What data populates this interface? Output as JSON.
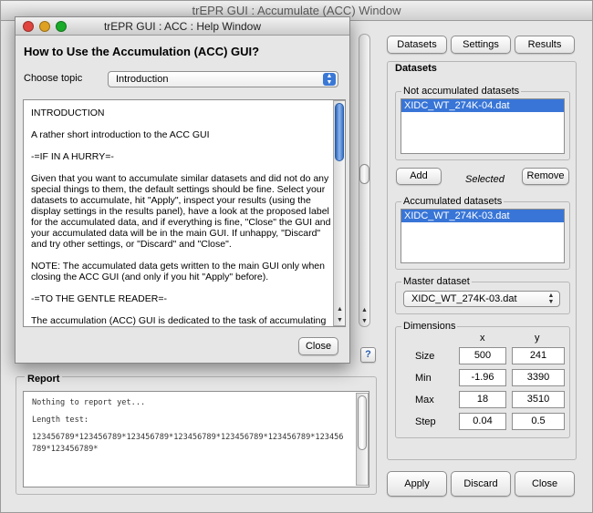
{
  "main_window": {
    "title": "trEPR GUI : Accumulate (ACC) Window"
  },
  "top_buttons": {
    "datasets": "Datasets",
    "settings": "Settings",
    "results": "Results"
  },
  "datasets_panel": {
    "title": "Datasets",
    "not_accumulated": {
      "title": "Not accumulated datasets",
      "items": [
        "XIDC_WT_274K-04.dat"
      ]
    },
    "add_button": "Add",
    "selected_label": "Selected",
    "remove_button": "Remove",
    "accumulated": {
      "title": "Accumulated datasets",
      "items": [
        "XIDC_WT_274K-03.dat"
      ]
    },
    "master": {
      "title": "Master dataset",
      "value": "XIDC_WT_274K-03.dat"
    },
    "dimensions": {
      "title": "Dimensions",
      "col_x": "x",
      "col_y": "y",
      "rows": [
        {
          "label": "Size",
          "x": "500",
          "y": "241"
        },
        {
          "label": "Min",
          "x": "-1.96",
          "y": "3390"
        },
        {
          "label": "Max",
          "x": "18",
          "y": "3510"
        },
        {
          "label": "Step",
          "x": "0.04",
          "y": "0.5"
        }
      ]
    }
  },
  "bottom_buttons": {
    "apply": "Apply",
    "discard": "Discard",
    "close": "Close"
  },
  "help_button": "?",
  "report": {
    "title": "Report",
    "lines": [
      "Nothing to report yet...",
      "Length test:",
      "123456789*123456789*123456789*123456789*123456789*123456789*123456789*123456789*"
    ]
  },
  "help_window": {
    "title": "trEPR GUI : ACC : Help Window",
    "heading": "How to Use the Accumulation (ACC) GUI?",
    "topic_label": "Choose topic",
    "topic_value": "Introduction",
    "paragraphs": [
      "INTRODUCTION",
      "A rather short introduction to the ACC GUI",
      "-=IF IN A HURRY=-",
      "Given that you want to accumulate similar datasets and did not do any special things to them, the default settings should be fine. Select your datasets to accumulate, hit \"Apply\", inspect your results (using the display settings in the results panel), have a look at the proposed label for the accumulated data, and if everything is fine, \"Close\" the GUI and your accumulated data will be in the main GUI. If unhappy, \"Discard\" and try other settings, or \"Discard\" and \"Close\".",
      "NOTE: The accumulated data gets written to the main GUI only when closing the ACC GUI (and only if you hit \"Apply\" before).",
      "-=TO THE GENTLE READER=-",
      "The accumulation (ACC) GUI is dedicated to the task of accumulating multiple datasets. Basically, it does not care about what data you want to"
    ],
    "close_button": "Close"
  },
  "colors": {
    "selection": "#3875d7",
    "traffic_red": "#e0443e",
    "traffic_yellow": "#dea123",
    "traffic_green": "#1aab29"
  }
}
